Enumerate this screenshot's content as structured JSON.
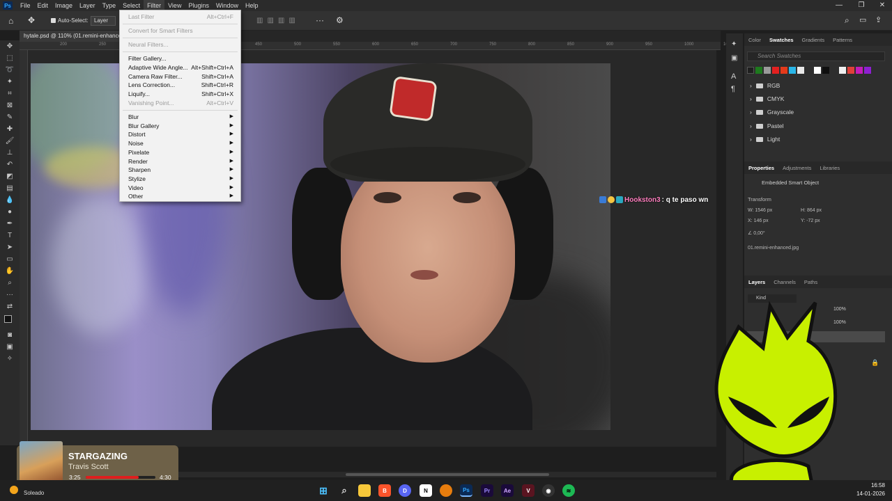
{
  "menubar": {
    "logo": "Ps",
    "items": [
      "File",
      "Edit",
      "Image",
      "Layer",
      "Type",
      "Select",
      "Filter",
      "View",
      "Plugins",
      "Window",
      "Help"
    ]
  },
  "options": {
    "auto_select": "Auto-Select:",
    "layer_dropdown": "Layer"
  },
  "document": {
    "tab_title": "hytale.psd @ 110% (01.remini-enhanced"
  },
  "filter_menu": {
    "last_filter": {
      "label": "Last Filter",
      "shortcut": "Alt+Ctrl+F"
    },
    "convert": {
      "label": "Convert for Smart Filters"
    },
    "neural": {
      "label": "Neural Filters..."
    },
    "gallery": {
      "label": "Filter Gallery..."
    },
    "adaptive": {
      "label": "Adaptive Wide Angle...",
      "shortcut": "Alt+Shift+Ctrl+A"
    },
    "camera_raw": {
      "label": "Camera Raw Filter...",
      "shortcut": "Shift+Ctrl+A"
    },
    "lens": {
      "label": "Lens Correction...",
      "shortcut": "Shift+Ctrl+R"
    },
    "liquify": {
      "label": "Liquify...",
      "shortcut": "Shift+Ctrl+X"
    },
    "vanishing": {
      "label": "Vanishing Point...",
      "shortcut": "Alt+Ctrl+V"
    },
    "submenus": [
      "Blur",
      "Blur Gallery",
      "Distort",
      "Noise",
      "Pixelate",
      "Render",
      "Sharpen",
      "Stylize",
      "Video",
      "Other"
    ]
  },
  "ruler": {
    "ticks": [
      "200",
      "250",
      "300",
      "350",
      "400",
      "450",
      "500",
      "550",
      "600",
      "650",
      "700",
      "750",
      "800",
      "850",
      "900",
      "950",
      "1000",
      "1050"
    ]
  },
  "swatches_panel": {
    "tabs": [
      "Color",
      "Swatches",
      "Gradients",
      "Patterns"
    ],
    "search_placeholder": "Search Swatches",
    "colors": [
      "#1f1f1f",
      "#1e7a1e",
      "#9a9a9a",
      "#e32020",
      "#e33a1b",
      "#2ab6e8",
      "#e8e8e8",
      "#ffffff",
      "#0f0f0f",
      "#f0f0f0",
      "#e0403a",
      "#c41db9",
      "#8e1fd1"
    ],
    "folders": [
      "RGB",
      "CMYK",
      "Grayscale",
      "Pastel",
      "Light"
    ]
  },
  "properties_panel": {
    "tabs": [
      "Properties",
      "Adjustments",
      "Libraries"
    ],
    "object_type": "Embedded Smart Object",
    "section": "Transform",
    "w": "1546 px",
    "h": "864 px",
    "x": "146 px",
    "y": "-72 px",
    "angle": "0,00°",
    "filename": "01.remini-enhanced.jpg"
  },
  "layers_panel": {
    "tabs": [
      "Layers",
      "Channels",
      "Paths"
    ],
    "filter": "Kind",
    "opacity": "100%",
    "fill": "100%"
  },
  "chat": {
    "user": "Hookston3",
    "message": ": q te paso wn",
    "user_color": "#ff7fbf"
  },
  "music": {
    "title": "STARGAZING",
    "artist": "Travis Scott",
    "elapsed": "3:25",
    "total": "4:30",
    "progress": 0.76
  },
  "taskbar": {
    "weather": "Soleado",
    "time": "16:58",
    "date": "14-01-2026"
  }
}
